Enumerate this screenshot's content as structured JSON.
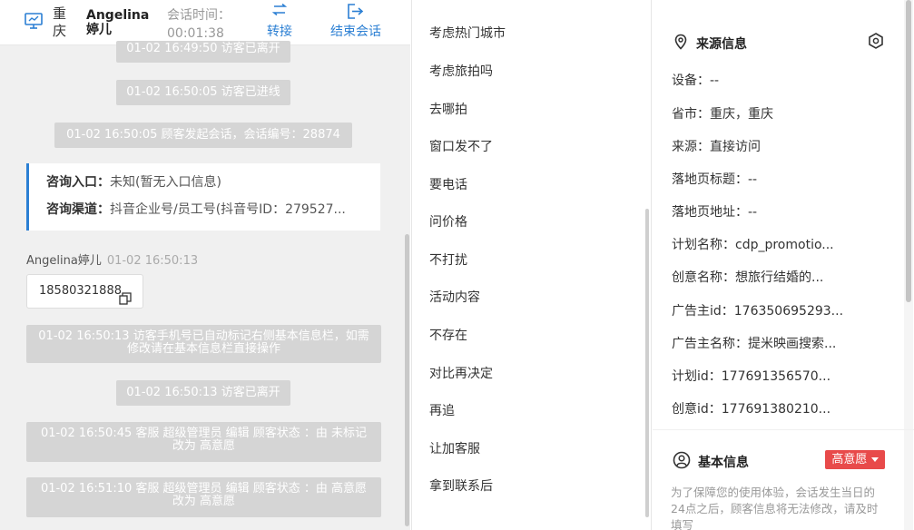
{
  "header": {
    "city": "重庆",
    "visitor_name": "Angelina婷儿",
    "session_time_label": "会话时间：",
    "session_time": "00:01:38",
    "transfer_label": "转接",
    "end_label": "结束会话"
  },
  "chat": {
    "sys_left_top": "01-02 16:49:50 访客已离开",
    "sys_enter": "01-02 16:50:05 访客已进线",
    "sys_session_start": "01-02 16:50:05 顾客发起会话，会话编号：28874",
    "consult_entry_key": "咨询入口：",
    "consult_entry_val": "未知(暂无入口信息)",
    "consult_channel_key": "咨询渠道：",
    "consult_channel_val": "抖音企业号/员工号(抖音号ID：279527...",
    "agent_name": "Angelina婷儿",
    "agent_time": "01-02 16:50:13",
    "phone": "18580321888",
    "sys_phone_marked": "01-02 16:50:13 访客手机号已自动标记右侧基本信息栏，如需修改请在基本信息栏直接操作",
    "sys_left_2": "01-02 16:50:13 访客已离开",
    "sys_edit_1": "01-02 16:50:45 客服 超级管理员 编辑 顾客状态 ：由 未标记 改为 高意愿",
    "sys_edit_2": "01-02 16:51:10 客服 超级管理员 编辑 顾客状态 ：由 高意愿 改为 高意愿"
  },
  "replies": [
    "考虑热门城市",
    "考虑旅拍吗",
    "去哪拍",
    "窗口发不了",
    "要电话",
    "问价格",
    "不打扰",
    "活动内容",
    "不存在",
    "对比再决定",
    "再追",
    "让加客服",
    "拿到联系后"
  ],
  "source": {
    "title": "来源信息",
    "device": "设备：--",
    "province": "省市：重庆，重庆",
    "origin": "来源：直接访问",
    "landing_title": "落地页标题：--",
    "landing_url": "落地页地址：--",
    "plan_name": "计划名称：cdp_promotio...",
    "creative_name": "创意名称：想旅行结婚的...",
    "advertiser_id": "广告主id：176350695293...",
    "advertiser_name": "广告主名称：提米映画搜索...",
    "plan_id": "计划id：177691356570...",
    "creative_id": "创意id：177691380210..."
  },
  "basic": {
    "title": "基本信息",
    "status_badge": "高意愿",
    "notice": "为了保障您的使用体验，会话发生当日的24点之后，顾客信息将无法修改，请及时填写"
  },
  "colors": {
    "accent": "#2b7fd3",
    "badge": "#e84a4a",
    "system_bubble": "#d5d5d5"
  },
  "icons": [
    "monitor-icon",
    "transfer-icon",
    "logout-icon",
    "copy-icon",
    "location-pin-icon",
    "settings-hex-icon",
    "user-circle-icon",
    "caret-down-icon"
  ]
}
